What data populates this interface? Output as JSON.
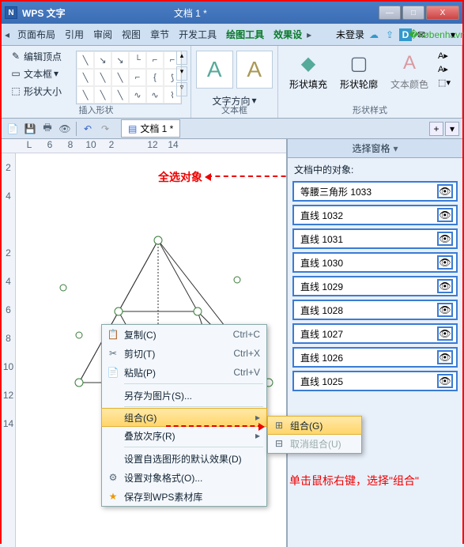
{
  "title": {
    "app": "WPS 文字",
    "doc": "文档 1 *"
  },
  "winbtns": {
    "min": "—",
    "max": "□",
    "close": "X"
  },
  "tabs": {
    "prev": "◂",
    "t1": "页面布局",
    "t2": "引用",
    "t3": "审阅",
    "t4": "视图",
    "t5": "章节",
    "t6": "开发工具",
    "t7": "绘图工具",
    "t8": "效果设",
    "next": "▸",
    "login": "未登录"
  },
  "ribbon": {
    "g1": {
      "btn1": "编辑顶点",
      "btn2": "文本框",
      "btn3": "形状大小",
      "label": "插入形状"
    },
    "g2": {
      "btn1": "文字方向",
      "label": "文本框"
    },
    "g3": {
      "btn1": "形状填充",
      "btn2": "形状轮廓",
      "btn3": "文本颜色",
      "label": "形状样式"
    }
  },
  "qat": {
    "doctab": "文档 1 *"
  },
  "hruler": [
    "L",
    "6",
    "8",
    "10",
    "2",
    "",
    "12",
    "14",
    "",
    "",
    "",
    "",
    ""
  ],
  "vruler": [
    "2",
    "4",
    "",
    "2",
    "4",
    "6",
    "8",
    "10",
    "12",
    "14"
  ],
  "annot": {
    "a1": "全选对象",
    "a2": "单击鼠标右键，选择\"组合\""
  },
  "ctx": {
    "copy": {
      "l": "复制(C)",
      "s": "Ctrl+C"
    },
    "cut": {
      "l": "剪切(T)",
      "s": "Ctrl+X"
    },
    "paste": {
      "l": "粘贴(P)",
      "s": "Ctrl+V"
    },
    "saveimg": {
      "l": "另存为图片(S)..."
    },
    "group": {
      "l": "组合(G)"
    },
    "order": {
      "l": "叠放次序(R)"
    },
    "default": {
      "l": "设置自选图形的默认效果(D)"
    },
    "format": {
      "l": "设置对象格式(O)..."
    },
    "savewps": {
      "l": "保存到WPS素材库"
    }
  },
  "sub": {
    "group": "组合(G)",
    "ungroup": "取消组合(U)"
  },
  "side": {
    "title": "选择窗格",
    "label": "文档中的对象:",
    "items": [
      "等腰三角形 1033",
      "直线 1032",
      "直线 1031",
      "直线 1030",
      "直线 1029",
      "直线 1028",
      "直线 1027",
      "直线 1026",
      "直线 1025"
    ]
  }
}
